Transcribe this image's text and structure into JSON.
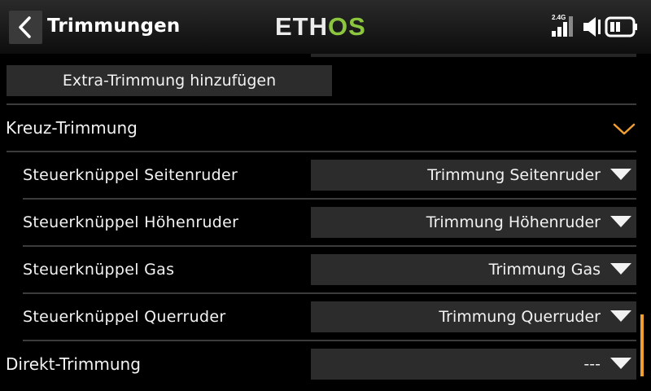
{
  "header": {
    "title": "Trimmungen",
    "logo_main": "ETH",
    "logo_accent": "OS",
    "logo_accent_color": "#8cc63f",
    "band": "2.4G",
    "back_icon": "chevron-left-icon",
    "signal_icon": "signal-bars-icon",
    "volume_icon": "speaker-muted-icon",
    "battery_icon": "battery-icon"
  },
  "add_trim_button": "Extra-Trimmung hinzufügen",
  "cross_trim": {
    "label": "Kreuz-Trimmung",
    "expanded": true,
    "accent_color": "#f0a030",
    "rows": [
      {
        "label": "Steuerknüppel Seitenruder",
        "value": "Trimmung Seitenruder"
      },
      {
        "label": "Steuerknüppel Höhenruder",
        "value": "Trimmung Höhenruder"
      },
      {
        "label": "Steuerknüppel Gas",
        "value": "Trimmung Gas"
      },
      {
        "label": "Steuerknüppel Querruder",
        "value": "Trimmung Querruder"
      }
    ]
  },
  "direct_trim": {
    "label": "Direkt-Trimmung",
    "value": "---"
  }
}
